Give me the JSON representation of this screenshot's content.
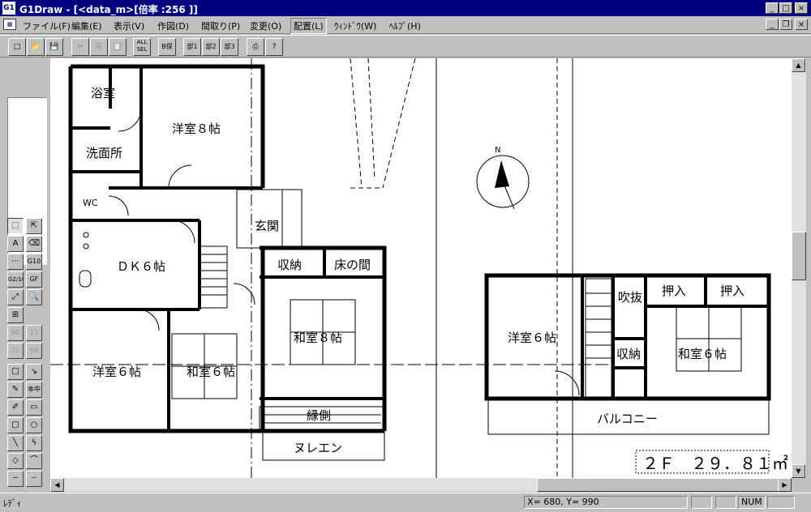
{
  "window": {
    "title": "G1Draw - [<data_m>[倍率 :256 ]]",
    "app_icon": "G1",
    "minimize": "_",
    "maximize": "□",
    "close": "×"
  },
  "menu": [
    {
      "label": "ファイル(F)"
    },
    {
      "label": "編集(E)"
    },
    {
      "label": "表示(V)"
    },
    {
      "label": "作図(D)"
    },
    {
      "label": "間取り(P)"
    },
    {
      "label": "変更(O)"
    },
    {
      "label": "配置(L)"
    },
    {
      "label": "ｳｨﾝﾄﾞｳ(W)"
    },
    {
      "label": "ﾍﾙﾌﾟ(H)"
    }
  ],
  "toolbar": {
    "new": "□",
    "open": "📂",
    "save": "💾",
    "cut": "✂",
    "copy": "⎘",
    "paste": "📋",
    "all_sel": "ALL SEL",
    "b_ho": "B保",
    "bu1": "部1",
    "bu2": "部2",
    "bu3": "部3",
    "print": "⎙",
    "help": "?"
  },
  "tools": {
    "select": "⬚",
    "move": "⇱",
    "text": "A",
    "eraser": "⌫",
    "grid": "⋯",
    "g10": "G10",
    "g210": "G2/10",
    "gf": "GF",
    "zoom_fit": "⤢",
    "zoom": "🔍",
    "plus": "⊞",
    "s60": "60",
    "s13": "13",
    "s27": "27",
    "s69": "69",
    "rect": "□",
    "arrow": "↘",
    "pen": "✎",
    "kozu": "本中",
    "brush": "✐",
    "box": "▭",
    "round": "▢",
    "ellipse": "○",
    "line": "╲",
    "bolt": "ϟ",
    "diamond": "◇",
    "curve": "⌒",
    "dash": "┄",
    "dot": "┈"
  },
  "plan": {
    "rooms": {
      "bath": "浴室",
      "yoshitsu8": "洋室８帖",
      "senmen": "洗面所",
      "wc": "WC",
      "genkan": "玄関",
      "dk6": "ＤＫ６帖",
      "shuno1": "収納",
      "tokonoma": "床の間",
      "washitsu8": "和室８帖",
      "yoshitsu6a": "洋室６帖",
      "washitsu6a": "和室６帖",
      "engawa": "縁側",
      "nuren": "ヌレエン",
      "yoshitsu6b": "洋室６帖",
      "fukinuke": "吹抜",
      "oshiire1": "押入",
      "oshiire2": "押入",
      "shuno2": "収納",
      "washitsu6b": "和室６帖",
      "balcony": "バルコニー"
    },
    "compass": "N",
    "floor_label": "２Ｆ　２９．８１㎡"
  },
  "status": {
    "text": "ﾚﾃﾞｨ",
    "coords": "X=   680, Y=   990",
    "num": "NUM"
  }
}
